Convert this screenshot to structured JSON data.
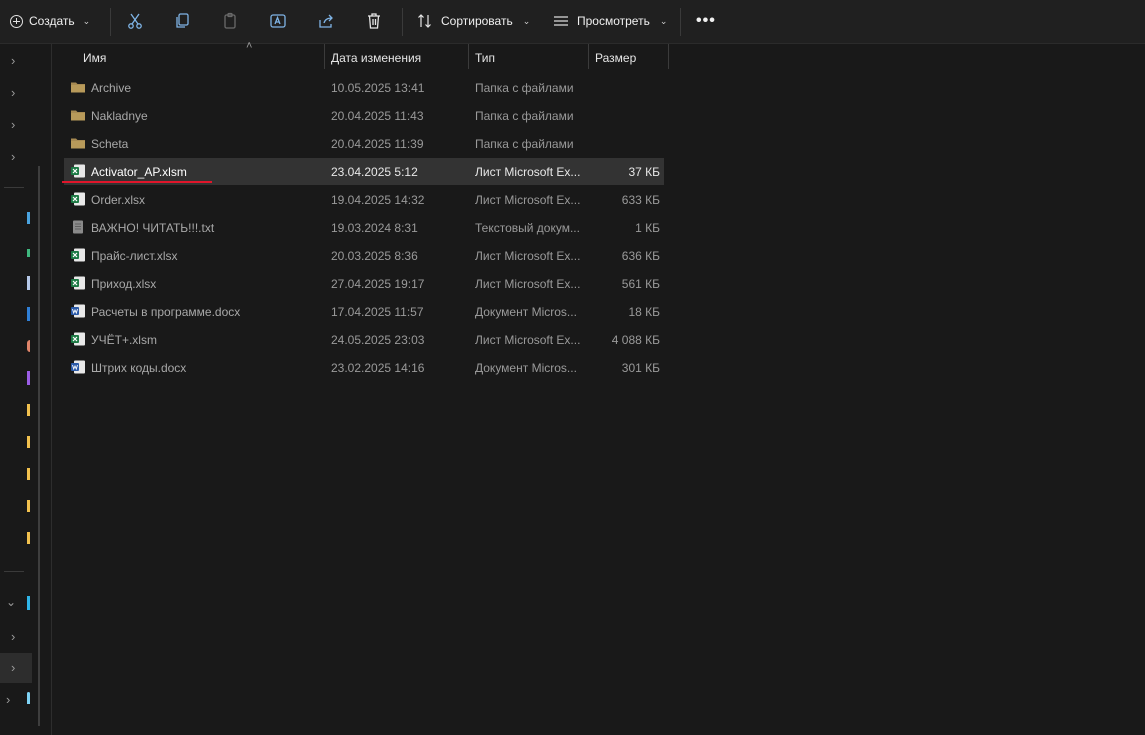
{
  "toolbar": {
    "create_label": "Создать",
    "sort_label": "Сортировать",
    "view_label": "Просмотреть",
    "more_label": "•••",
    "icons": [
      "cut-icon",
      "copy-icon",
      "paste-icon",
      "rename-icon",
      "share-icon",
      "delete-icon",
      "sort-icon",
      "view-icon",
      "more-icon"
    ]
  },
  "columns": {
    "name": "Имя",
    "date": "Дата изменения",
    "type": "Тип",
    "size": "Размер"
  },
  "files": [
    {
      "name": "Archive",
      "date": "10.05.2025 13:41",
      "type": "Папка с файлами",
      "size": "",
      "icon": "folder-icon"
    },
    {
      "name": "Nakladnye",
      "date": "20.04.2025 11:43",
      "type": "Папка с файлами",
      "size": "",
      "icon": "folder-icon"
    },
    {
      "name": "Scheta",
      "date": "20.04.2025 11:39",
      "type": "Папка с файлами",
      "size": "",
      "icon": "folder-icon"
    },
    {
      "name": "Activator_AP.xlsm",
      "date": "23.04.2025 5:12",
      "type": "Лист Microsoft Ex...",
      "size": "37 КБ",
      "icon": "excel-file-icon",
      "selected": true
    },
    {
      "name": "Order.xlsx",
      "date": "19.04.2025 14:32",
      "type": "Лист Microsoft Ex...",
      "size": "633 КБ",
      "icon": "excel-file-icon"
    },
    {
      "name": "ВАЖНО! ЧИТАТЬ!!!.txt",
      "date": "19.03.2024 8:31",
      "type": "Текстовый докум...",
      "size": "1 КБ",
      "icon": "text-file-icon"
    },
    {
      "name": "Прайс-лист.xlsx",
      "date": "20.03.2025 8:36",
      "type": "Лист Microsoft Ex...",
      "size": "636 КБ",
      "icon": "excel-file-icon"
    },
    {
      "name": "Приход.xlsx",
      "date": "27.04.2025 19:17",
      "type": "Лист Microsoft Ex...",
      "size": "561 КБ",
      "icon": "excel-file-icon"
    },
    {
      "name": "Расчеты в программе.docx",
      "date": "17.04.2025 11:57",
      "type": "Документ Micros...",
      "size": "18 КБ",
      "icon": "word-file-icon"
    },
    {
      "name": "УЧЁТ+.xlsm",
      "date": "24.05.2025 23:03",
      "type": "Лист Microsoft Ex...",
      "size": "4 088 КБ",
      "icon": "excel-file-icon"
    },
    {
      "name": "Штрих коды.docx",
      "date": "23.02.2025 14:16",
      "type": "Документ Micros...",
      "size": "301 КБ",
      "icon": "word-file-icon"
    }
  ],
  "colors": {
    "background": "#191919",
    "toolbar": "#202020",
    "selection": "#333333",
    "annotation_underline": "#e0162b",
    "folder": "#b89a5a",
    "excel": "#1d7a45",
    "word": "#2b5aa8"
  }
}
